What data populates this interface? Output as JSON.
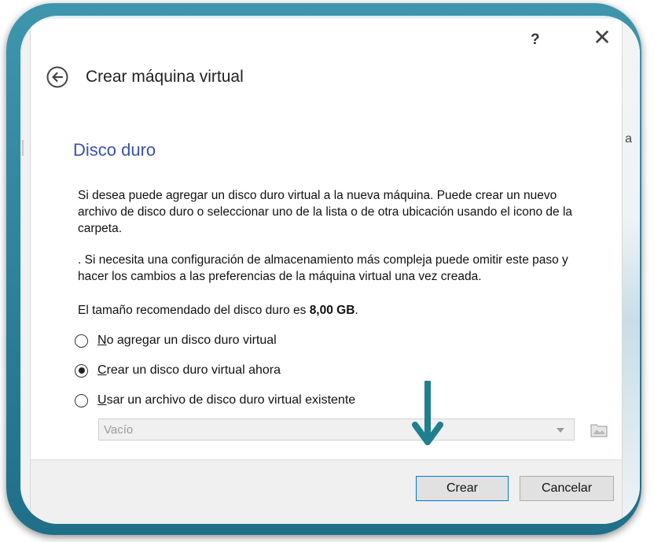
{
  "window": {
    "help_label": "?",
    "close_label": "✕"
  },
  "header": {
    "title": "Crear máquina virtual"
  },
  "page": {
    "section_title": "Disco duro",
    "paragraph1": "Si desea puede agregar un disco duro virtual a la nueva máquina. Puede crear un nuevo archivo de disco duro o seleccionar uno de la lista o de otra ubicación usando el icono de la carpeta.",
    "paragraph2": ". Si necesita una configuración de almacenamiento más compleja puede omitir este paso y hacer los cambios a las preferencias de la máquina virtual una vez creada.",
    "recommended_prefix": "El tamaño recomendado del disco duro es ",
    "recommended_size": "8,00 GB",
    "recommended_suffix": "."
  },
  "options": {
    "no_disk": {
      "first": "N",
      "rest": "o agregar un disco duro virtual",
      "selected": false
    },
    "create_disk": {
      "first": "C",
      "rest": "rear un disco duro virtual ahora",
      "selected": true
    },
    "existing_disk": {
      "first": "U",
      "rest": "sar un archivo de disco duro virtual existente",
      "selected": false
    }
  },
  "disk_select": {
    "value": "Vacío"
  },
  "buttons": {
    "create": "Crear",
    "cancel": "Cancelar"
  },
  "background": {
    "edge_letter": "a"
  },
  "colors": {
    "frame": "#2a7f99",
    "section_title": "#3a52b0",
    "pointer_arrow": "#1f7f8f"
  },
  "icons": [
    "back-arrow-icon",
    "close-icon",
    "folder-icon",
    "down-arrow-icon"
  ]
}
